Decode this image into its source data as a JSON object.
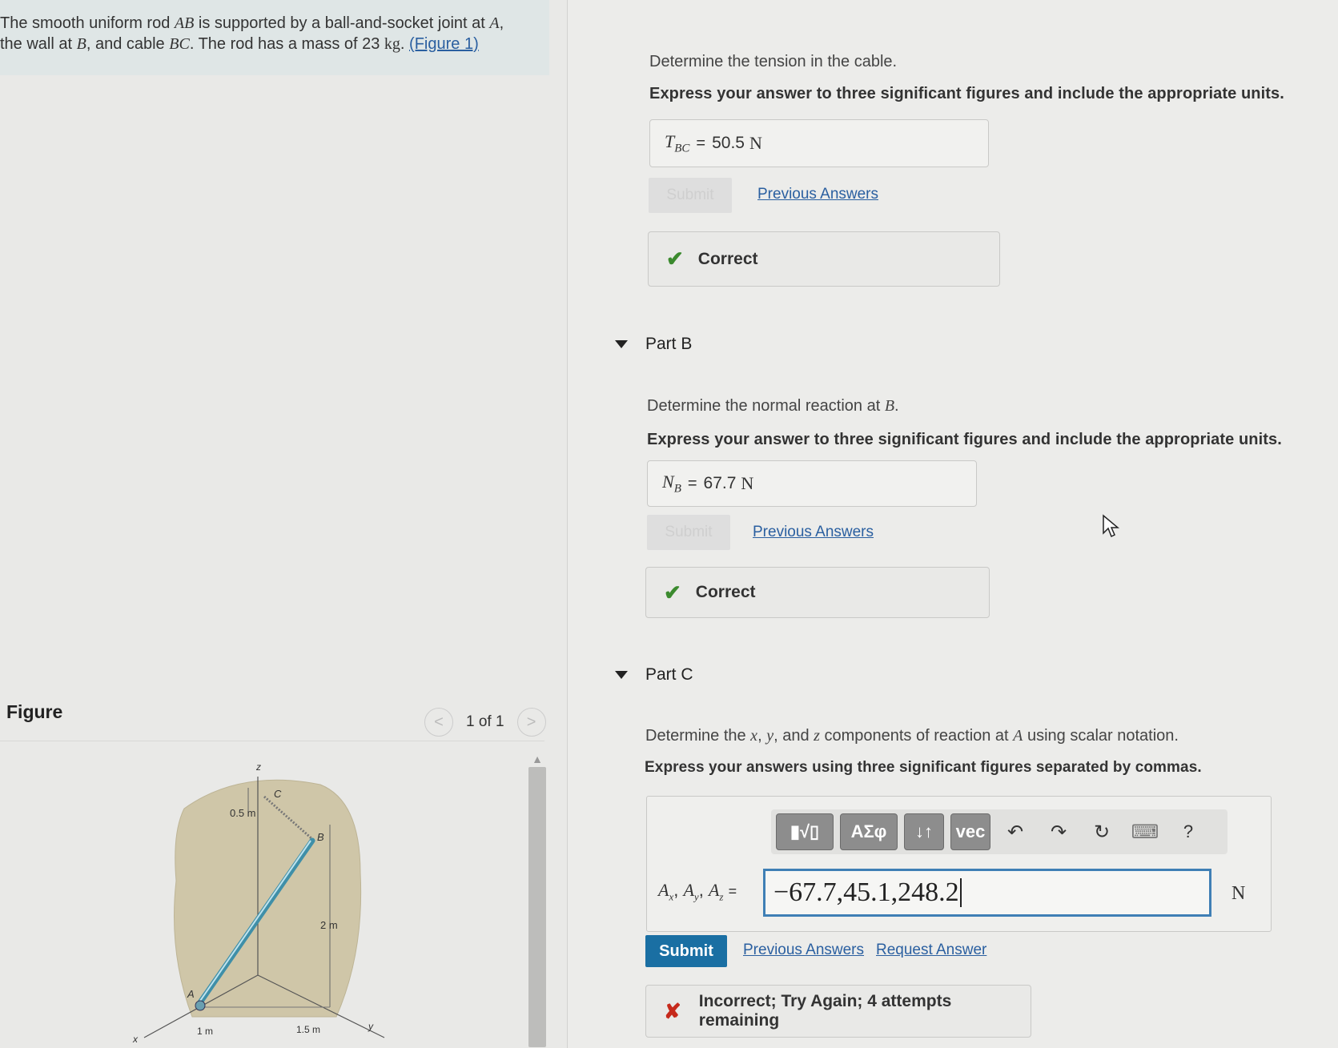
{
  "problem": {
    "line1_pre": "The smooth uniform rod ",
    "line1_var_rod": "AB",
    "line1_mid": " is supported by a ball-and-socket joint at ",
    "line1_var_a": "A",
    "line1_end": ",",
    "line2_pre": "the wall at ",
    "line2_var_b": "B",
    "line2_mid": ", and cable ",
    "line2_var_bc": "BC",
    "line2_mass_text": ". The rod has a mass of 23 ",
    "line2_unit": "kg",
    "line2_dot": ".",
    "figure_link": "(Figure 1)"
  },
  "figure_panel": {
    "header": "Figure",
    "pager": "1 of 1",
    "prev_glyph": "<",
    "next_glyph": ">",
    "labels": {
      "z": "z",
      "c": "C",
      "b": "B",
      "a": "A",
      "x": "x",
      "y": "y",
      "d_05": "0.5 m",
      "d_2": "2 m",
      "d_1": "1 m",
      "d_15": "1.5 m"
    }
  },
  "part_a": {
    "prompt": "Determine the tension in the cable.",
    "instruction": "Express your answer to three significant figures and include the appropriate units.",
    "var_main": "T",
    "var_sub": "BC",
    "equals": "=",
    "value": "50.5",
    "unit": "N",
    "submit_label": "Submit",
    "previous_answers": "Previous Answers",
    "feedback": "Correct"
  },
  "part_b": {
    "title": "Part B",
    "prompt_pre": "Determine the normal reaction at ",
    "prompt_var": "B",
    "prompt_end": ".",
    "instruction": "Express your answer to three significant figures and include the appropriate units.",
    "var_main": "N",
    "var_sub": "B",
    "equals": "=",
    "value": "67.7",
    "unit": "N",
    "submit_label": "Submit",
    "previous_answers": "Previous Answers",
    "feedback": "Correct"
  },
  "part_c": {
    "title": "Part C",
    "prompt_pre": "Determine the ",
    "prompt_x": "x",
    "prompt_c1": ", ",
    "prompt_y": "y",
    "prompt_c2": ", and ",
    "prompt_z": "z",
    "prompt_mid": " components of reaction at ",
    "prompt_a": "A",
    "prompt_end": " using scalar notation.",
    "instruction": "Express your answers using three significant figures separated by commas.",
    "toolbar": {
      "templates": "▮√▯",
      "greek": "ΑΣφ",
      "arrows": "↓↑",
      "vec": "vec",
      "undo_glyph": "↶",
      "redo_glyph": "↷",
      "reset_glyph": "↻",
      "keyboard_glyph": "⌨",
      "help_glyph": "?"
    },
    "var_label": "A",
    "sub_x": "x",
    "sub_y": "y",
    "sub_z": "z",
    "equals": "=",
    "input_value": "−67.7,45.1,248.2",
    "unit": "N",
    "submit_label": "Submit",
    "previous_answers": "Previous Answers",
    "request_answer": "Request Answer",
    "feedback": "Incorrect; Try Again; 4 attempts remaining"
  },
  "icons": {
    "check": "check-icon",
    "x": "x-icon",
    "triangle": "disclosure-triangle-icon"
  },
  "colors": {
    "link": "#2a5fa0",
    "submit": "#1a6fa3",
    "correct": "#3b8a2e",
    "incorrect": "#c62a1c",
    "input_border": "#3f7fb5"
  }
}
